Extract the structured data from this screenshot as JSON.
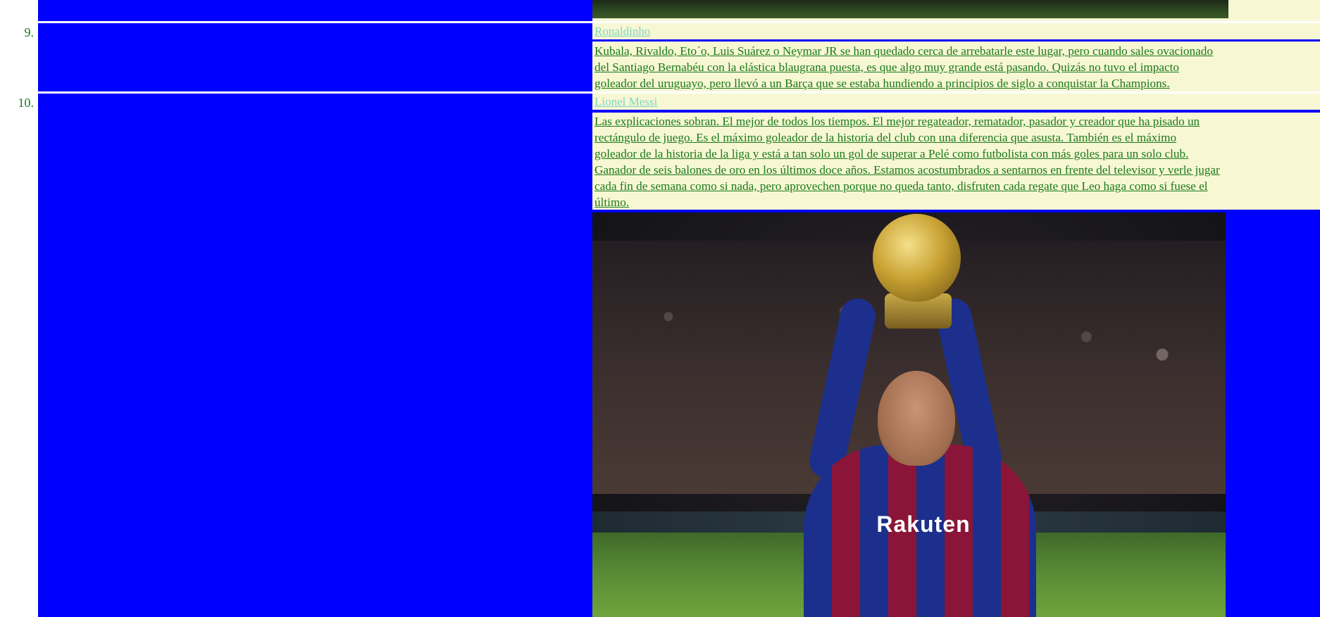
{
  "list": {
    "items": [
      {
        "number": "9.",
        "title": "Ronaldinho",
        "description_lines": [
          "Kubala, Rivaldo, Eto´o, Luis Suárez o Neymar JR se han quedado cerca de arrebatarle este lugar, pero cuando sales ovacionado",
          "del Santiago Bernabéu con la elástica blaugrana puesta, es que algo muy grande está pasando. Quizás no tuvo el impacto",
          "goleador del uruguayo, pero llevó a un Barça que se estaba hundiendo a principios de siglo a conquistar la Champions."
        ]
      },
      {
        "number": "10.",
        "title": "Lionel Messi",
        "description_lines": [
          "Las explicaciones sobran. El mejor de todos los tiempos. El mejor regateador, rematador, pasador y creador que ha pisado un",
          "rectángulo de juego. Es el máximo goleador de la historia del club con una diferencia que asusta. También es el máximo",
          "goleador de la historia de la liga y está a tan solo un gol de superar a Pelé como futbolista con más goles para un solo club.",
          "Ganador de seis balones de oro en los últimos doce años. Estamos acostumbrados a sentarnos en frente del televisor y verle jugar",
          "cada fin de semana como si nada, pero aprovechen porque no queda tanto, disfruten cada regate que Leo haga como si fuese el",
          "último."
        ],
        "photo_sponsor_text": "Rakuten"
      }
    ]
  },
  "colors": {
    "blue_panel": "#0000ff",
    "cream_background": "#f7f7d4",
    "link_green": "#1a7a1a",
    "title_cyan": "#7fd6c2"
  }
}
